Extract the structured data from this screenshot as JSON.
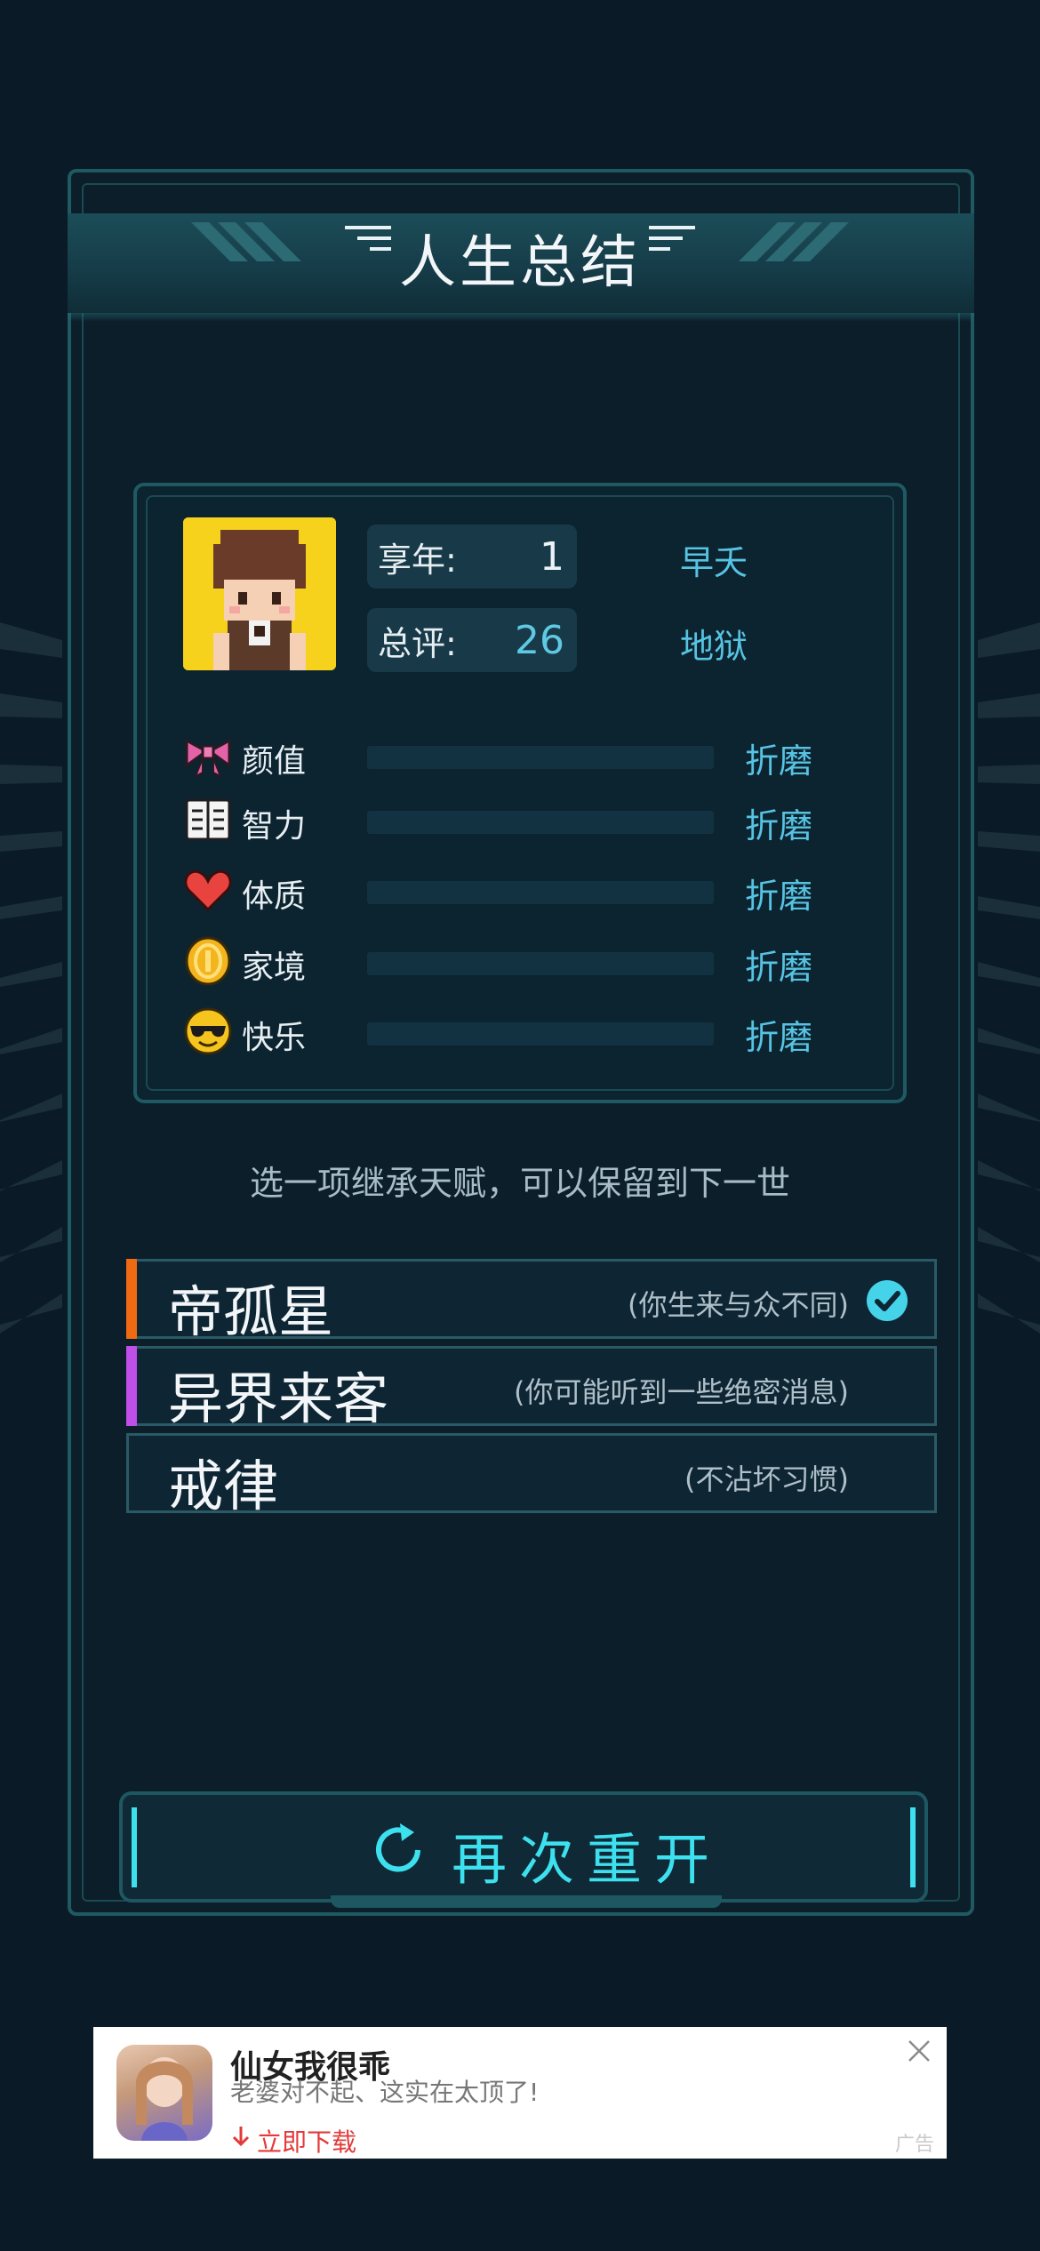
{
  "title": "人生总结",
  "summary": {
    "age_label": "享年:",
    "age_value": "1",
    "age_rating": "早夭",
    "score_label": "总评:",
    "score_value": "26",
    "score_rating": "地狱"
  },
  "attributes": [
    {
      "label": "颜值",
      "value": "折磨",
      "icon": "bow-icon",
      "level": 0
    },
    {
      "label": "智力",
      "value": "折磨",
      "icon": "book-icon",
      "level": 0
    },
    {
      "label": "体质",
      "value": "折磨",
      "icon": "heart-icon",
      "level": 0
    },
    {
      "label": "家境",
      "value": "折磨",
      "icon": "coin-icon",
      "level": 0
    },
    {
      "label": "快乐",
      "value": "折磨",
      "icon": "sunglasses-face-icon",
      "level": 0
    }
  ],
  "hint": "选一项继承天赋，可以保留到下一世",
  "talents": [
    {
      "name": "帝孤星",
      "desc": "(你生来与众不同)",
      "color": "#f06a12",
      "selected": true
    },
    {
      "name": "异界来客",
      "desc": "(你可能听到一些绝密消息)",
      "color": "#c04ee8",
      "selected": false
    },
    {
      "name": "戒律",
      "desc": "(不沾坏习惯)",
      "color": "",
      "selected": false
    }
  ],
  "restart_label": "再次重开",
  "ad": {
    "title": "仙女我很乖",
    "subtitle": "老婆对不起、这实在太顶了!",
    "cta": "立即下载",
    "tag": "广告"
  },
  "colors": {
    "accent_cyan": "#3de0ee",
    "rating_blue": "#57c3e2",
    "background": "#0a1a26"
  }
}
